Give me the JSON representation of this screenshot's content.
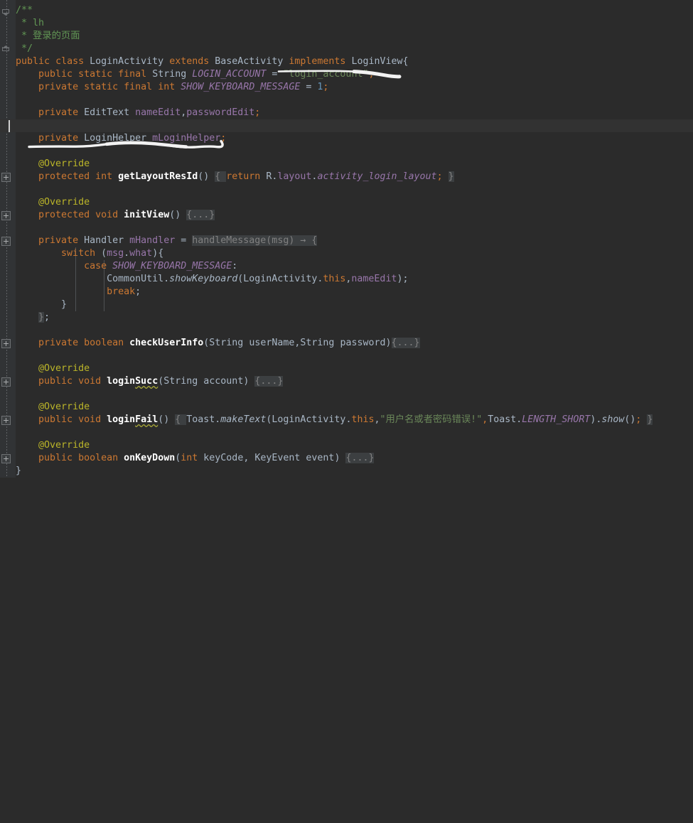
{
  "editor": {
    "theme": "darcula",
    "background": "#2B2B2B",
    "gutter_background": "#313335",
    "caret_line_background": "#323232",
    "default_text_color": "#A9B7C6",
    "keyword_color": "#CC7832",
    "string_color": "#6A8759",
    "comment_color": "#629755",
    "number_color": "#6897BB",
    "field_color": "#9876AA",
    "method_color": "#FFC66D",
    "annotation_color": "#BBB529",
    "folded_placeholder_color": "#808080",
    "annotation_ink_color": "#F2F2F2"
  },
  "code": {
    "language": "Java",
    "class_name": "LoginActivity",
    "folded_placeholder": "{...}",
    "lines": [
      {
        "n": 1,
        "text": "/**"
      },
      {
        "n": 2,
        "text": " * lh"
      },
      {
        "n": 3,
        "text": " * 登录的页面"
      },
      {
        "n": 4,
        "text": " */"
      },
      {
        "n": 5,
        "text": "public class LoginActivity extends BaseActivity implements LoginView{"
      },
      {
        "n": 6,
        "text": "    public static final String LOGIN_ACCOUNT = \"login_account\";"
      },
      {
        "n": 7,
        "text": "    private static final int SHOW_KEYBOARD_MESSAGE = 1;"
      },
      {
        "n": 8,
        "text": ""
      },
      {
        "n": 9,
        "text": "    private EditText nameEdit,passwordEdit;"
      },
      {
        "n": 10,
        "text": ""
      },
      {
        "n": 11,
        "text": "    private LoginHelper mLoginHelper;"
      },
      {
        "n": 12,
        "text": ""
      },
      {
        "n": 13,
        "text": "    @Override"
      },
      {
        "n": 14,
        "text": "    protected int getLayoutResId() { return R.layout.activity_login_layout; }"
      },
      {
        "n": 15,
        "text": ""
      },
      {
        "n": 16,
        "text": "    @Override"
      },
      {
        "n": 17,
        "text": "    protected void initView() {...}"
      },
      {
        "n": 18,
        "text": ""
      },
      {
        "n": 19,
        "text": "    private Handler mHandler = handleMessage(msg) → {"
      },
      {
        "n": 20,
        "text": "        switch (msg.what){"
      },
      {
        "n": 21,
        "text": "            case SHOW_KEYBOARD_MESSAGE:"
      },
      {
        "n": 22,
        "text": "                CommonUtil.showKeyboard(LoginActivity.this,nameEdit);"
      },
      {
        "n": 23,
        "text": "                break;"
      },
      {
        "n": 24,
        "text": "        }"
      },
      {
        "n": 25,
        "text": "    };"
      },
      {
        "n": 26,
        "text": ""
      },
      {
        "n": 27,
        "text": "    private boolean checkUserInfo(String userName,String password){...}"
      },
      {
        "n": 28,
        "text": ""
      },
      {
        "n": 29,
        "text": "    @Override"
      },
      {
        "n": 30,
        "text": "    public void loginSucc(String account) {...}"
      },
      {
        "n": 31,
        "text": ""
      },
      {
        "n": 32,
        "text": "    @Override"
      },
      {
        "n": 33,
        "text": "    public void loginFail() { Toast.makeText(LoginActivity.this,\"用户名或者密码错误!\",Toast.LENGTH_SHORT).show(); }"
      },
      {
        "n": 34,
        "text": ""
      },
      {
        "n": 35,
        "text": "    @Override"
      },
      {
        "n": 36,
        "text": "    public boolean onKeyDown(int keyCode, KeyEvent event) {...}"
      },
      {
        "n": 37,
        "text": "}"
      }
    ],
    "chinese_strings": {
      "javadoc_title": "登录的页面",
      "toast_message": "用户名或者密码错误!"
    }
  },
  "gutter": {
    "markers": [
      {
        "type": "fold-collapse",
        "line": 1
      },
      {
        "type": "fold-end",
        "line": 4
      },
      {
        "type": "fold-expand",
        "line": 14
      },
      {
        "type": "fold-expand",
        "line": 17
      },
      {
        "type": "fold-expand",
        "line": 19
      },
      {
        "type": "fold-expand",
        "line": 27
      },
      {
        "type": "fold-expand",
        "line": 30
      },
      {
        "type": "fold-expand",
        "line": 33
      },
      {
        "type": "fold-expand",
        "line": 36
      }
    ]
  },
  "caret": {
    "line": 10,
    "column": 1,
    "highlighted_line_text": ""
  },
  "ink_annotations": [
    {
      "name": "underline-implements-loginview",
      "target_text": "implements LoginView{",
      "color": "#F2F2F2"
    },
    {
      "name": "underline-login-helper-field",
      "target_text": "private LoginHelper mLoginHelper;",
      "color": "#F2F2F2"
    }
  ]
}
